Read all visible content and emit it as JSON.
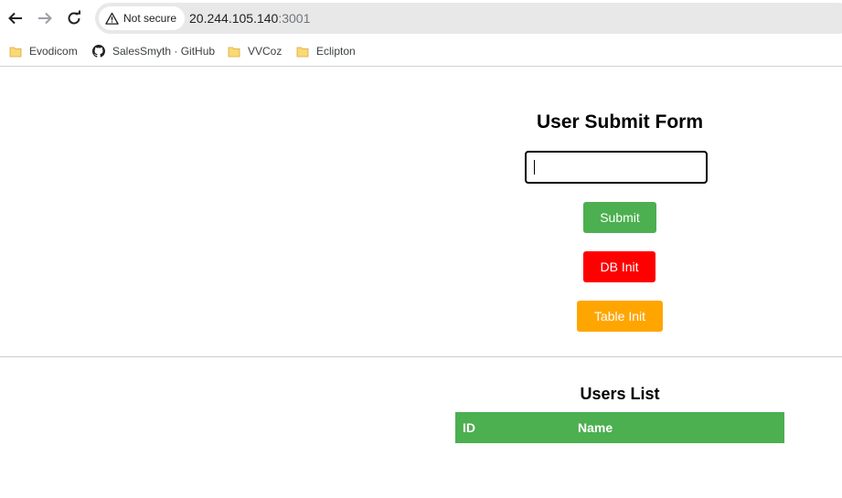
{
  "browser": {
    "security_label": "Not secure",
    "url_host": "20.244.105.140",
    "url_port": ":3001",
    "bookmarks": [
      {
        "label": "Evodicom",
        "icon": "folder-icon"
      },
      {
        "label": "SalesSmyth · GitHub",
        "icon": "github-icon"
      },
      {
        "label": "VVCoz",
        "icon": "folder-icon"
      },
      {
        "label": "Eclipton",
        "icon": "folder-icon"
      }
    ]
  },
  "form": {
    "title": "User Submit Form",
    "input_value": "",
    "submit_label": "Submit",
    "db_init_label": "DB Init",
    "table_init_label": "Table Init"
  },
  "users": {
    "title": "Users List",
    "columns": [
      "ID",
      "Name"
    ],
    "rows": []
  },
  "colors": {
    "submit": "#4caf50",
    "db_init": "#ff0000",
    "table_init": "#ffa500",
    "table_header": "#4caf50"
  }
}
